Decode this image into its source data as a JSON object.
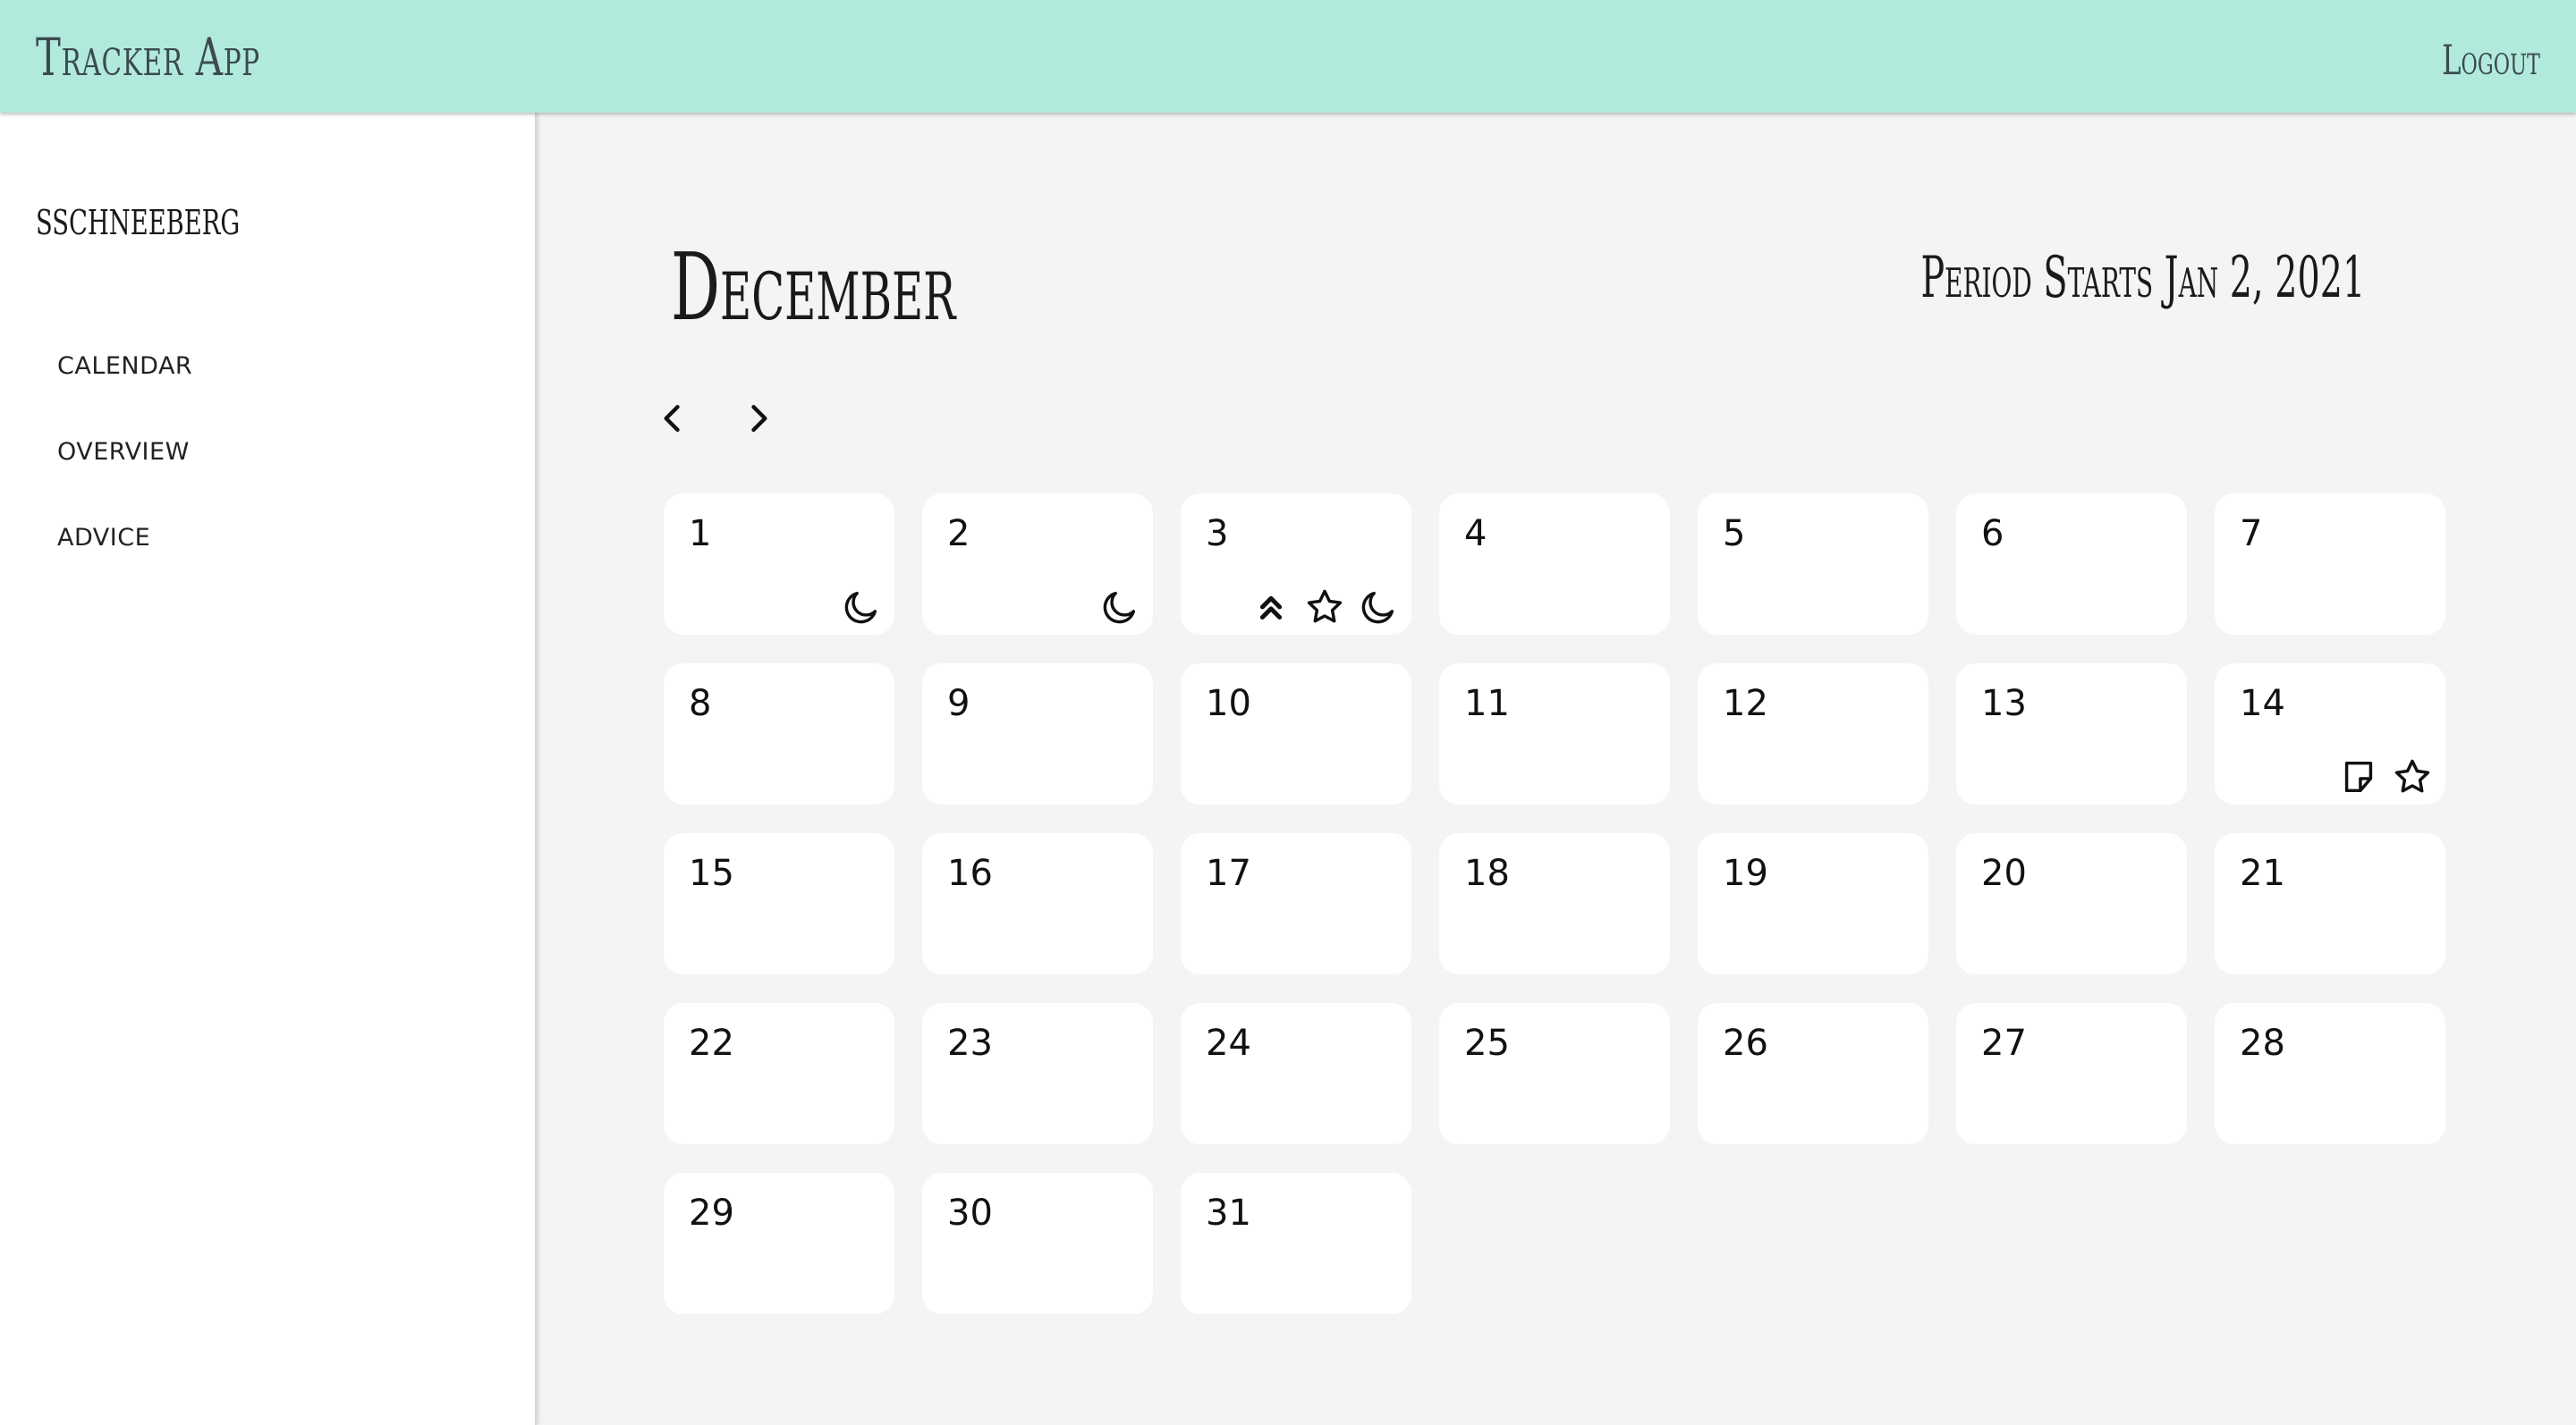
{
  "app": {
    "title": "Tracker App",
    "logout_label": "Logout"
  },
  "sidebar": {
    "username": "sschneeberg",
    "items": [
      {
        "label": "CALENDAR"
      },
      {
        "label": "OVERVIEW"
      },
      {
        "label": "ADVICE"
      }
    ]
  },
  "main": {
    "month": "December",
    "period_text": "Period Starts Jan 2, 2021",
    "prev_icon": "chevron-left-icon",
    "next_icon": "chevron-right-icon"
  },
  "calendar": {
    "days": [
      {
        "num": "1",
        "icons": [
          "moon"
        ]
      },
      {
        "num": "2",
        "icons": [
          "moon"
        ]
      },
      {
        "num": "3",
        "icons": [
          "double-up",
          "star",
          "moon"
        ]
      },
      {
        "num": "4",
        "icons": []
      },
      {
        "num": "5",
        "icons": []
      },
      {
        "num": "6",
        "icons": []
      },
      {
        "num": "7",
        "icons": []
      },
      {
        "num": "8",
        "icons": []
      },
      {
        "num": "9",
        "icons": []
      },
      {
        "num": "10",
        "icons": []
      },
      {
        "num": "11",
        "icons": []
      },
      {
        "num": "12",
        "icons": []
      },
      {
        "num": "13",
        "icons": []
      },
      {
        "num": "14",
        "icons": [
          "note",
          "star"
        ]
      },
      {
        "num": "15",
        "icons": []
      },
      {
        "num": "16",
        "icons": []
      },
      {
        "num": "17",
        "icons": []
      },
      {
        "num": "18",
        "icons": []
      },
      {
        "num": "19",
        "icons": []
      },
      {
        "num": "20",
        "icons": []
      },
      {
        "num": "21",
        "icons": []
      },
      {
        "num": "22",
        "icons": []
      },
      {
        "num": "23",
        "icons": []
      },
      {
        "num": "24",
        "icons": []
      },
      {
        "num": "25",
        "icons": []
      },
      {
        "num": "26",
        "icons": []
      },
      {
        "num": "27",
        "icons": []
      },
      {
        "num": "28",
        "icons": []
      },
      {
        "num": "29",
        "icons": []
      },
      {
        "num": "30",
        "icons": []
      },
      {
        "num": "31",
        "icons": []
      }
    ]
  },
  "colors": {
    "header_bg": "#b1eadd",
    "page_bg": "#f4f4f4",
    "card_bg": "#ffffff",
    "text": "#1a1a1a"
  }
}
